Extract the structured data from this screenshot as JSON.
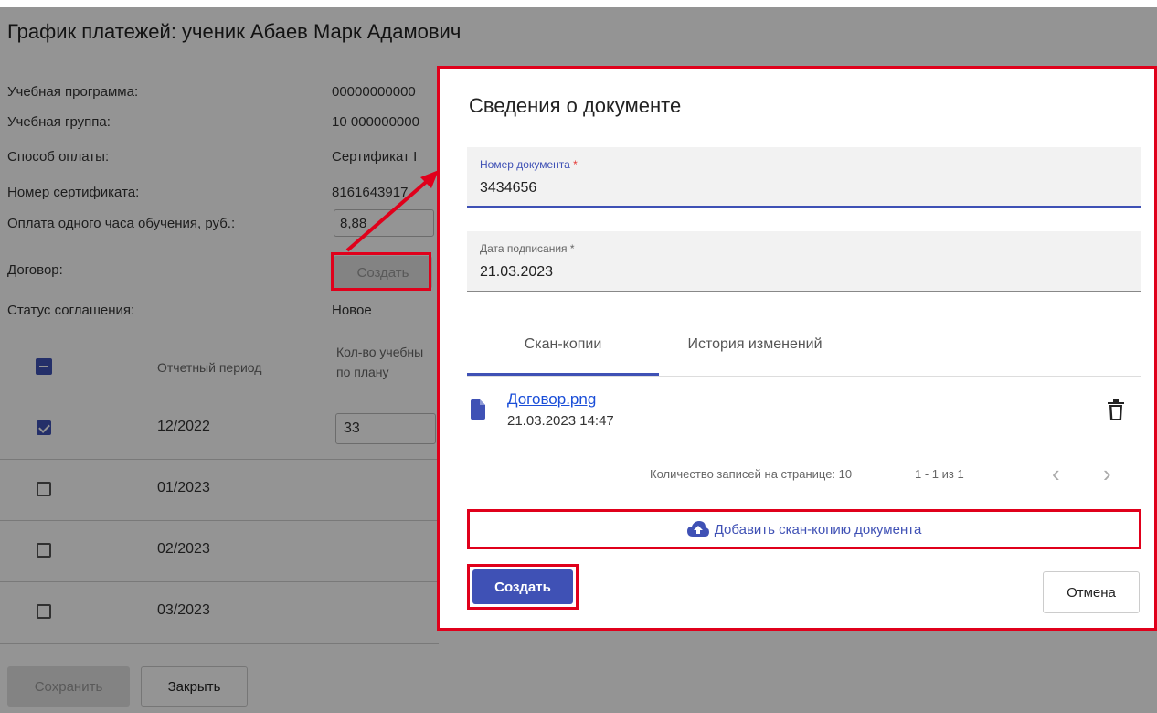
{
  "page": {
    "title": "График платежей: ученик Абаев Марк Адамович",
    "info": [
      {
        "label": "Учебная программа:",
        "value": "00000000000"
      },
      {
        "label": "Учебная группа:",
        "value": "10 000000000"
      },
      {
        "label": "Способ оплаты:",
        "value": "Сертификат I"
      },
      {
        "label": "Номер сертификата:",
        "value": "8161643917"
      },
      {
        "label": "Оплата одного часа обучения, руб.:",
        "value": "8,88"
      },
      {
        "label": "Договор:",
        "value": "Создать"
      },
      {
        "label": "Статус соглашения:",
        "value": "Новое"
      }
    ],
    "table": {
      "headers": {
        "period": "Отчетный период",
        "hours_line1": "Кол-во учебны",
        "hours_line2": "по плану"
      },
      "rows": [
        {
          "period": "12/2022",
          "hours": "33",
          "checked": true
        },
        {
          "period": "01/2023",
          "hours": "",
          "checked": false
        },
        {
          "period": "02/2023",
          "hours": "",
          "checked": false
        },
        {
          "period": "03/2023",
          "hours": "",
          "checked": false
        }
      ]
    },
    "save_label": "Сохранить",
    "close_label": "Закрыть"
  },
  "dialog": {
    "title": "Сведения о документе",
    "doc_number": {
      "label": "Номер документа",
      "required_mark": "*",
      "value": "3434656"
    },
    "sign_date": {
      "label": "Дата подписания",
      "required_mark": "*",
      "value": "21.03.2023"
    },
    "tabs": [
      {
        "label": "Скан-копии",
        "active": true
      },
      {
        "label": "История изменений",
        "active": false
      }
    ],
    "files": [
      {
        "name": "Договор.png",
        "date": "21.03.2023 14:47",
        "icon": "file-icon"
      }
    ],
    "pager": {
      "per_page_label": "Количество записей на странице: 10",
      "range": "1 - 1 из 1",
      "prev": "‹",
      "next": "›"
    },
    "add_scan_label": "Добавить скан-копию документа",
    "create_label": "Создать",
    "cancel_label": "Отмена"
  },
  "colors": {
    "accent": "#3f51b5",
    "highlight": "#e0001b",
    "link": "#1a4ed8"
  }
}
